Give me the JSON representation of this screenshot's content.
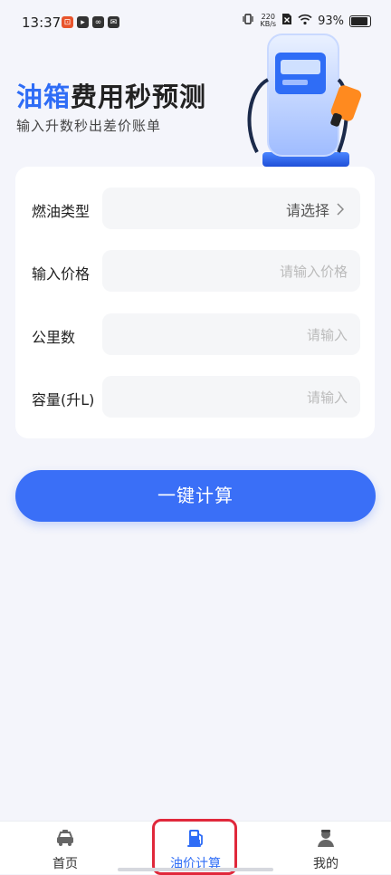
{
  "status_bar": {
    "time": "13:37",
    "net_speed_value": "220",
    "net_speed_unit": "KB/s",
    "battery": "93%"
  },
  "header": {
    "title_accent": "油箱",
    "title_rest": "费用秒预测",
    "subtitle": "输入升数秒出差价账单"
  },
  "form": {
    "fuel_type": {
      "label": "燃油类型",
      "value": "请选择"
    },
    "price": {
      "label": "输入价格",
      "placeholder": "请输入价格"
    },
    "distance": {
      "label": "公里数",
      "placeholder": "请输入"
    },
    "capacity": {
      "label": "容量(升L)",
      "placeholder": "请输入"
    }
  },
  "calc_button": "一键计算",
  "nav": {
    "items": [
      {
        "label": "首页",
        "icon": "car-icon",
        "active": false
      },
      {
        "label": "油价计算",
        "icon": "fuel-pump-icon",
        "active": true
      },
      {
        "label": "我的",
        "icon": "user-icon",
        "active": false
      }
    ]
  },
  "colors": {
    "accent": "#2f6df6",
    "button": "#3a6ff7",
    "highlight": "#e0283b"
  }
}
